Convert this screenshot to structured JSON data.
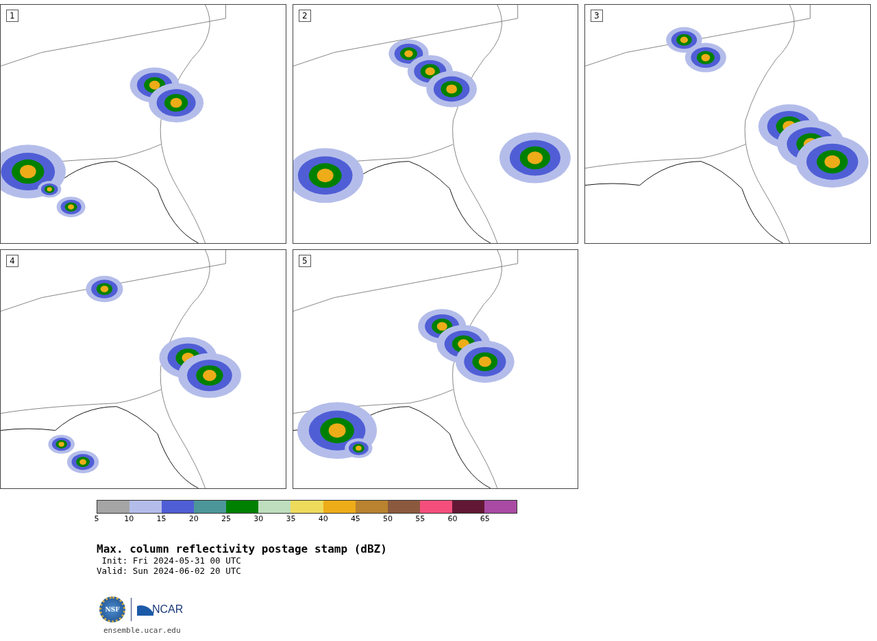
{
  "panels": [
    {
      "number": "1",
      "kind": "map-picture"
    },
    {
      "number": "2",
      "kind": "map-picture"
    },
    {
      "number": "3",
      "kind": "map-picture"
    },
    {
      "number": "4",
      "kind": "map-picture"
    },
    {
      "number": "5",
      "kind": "map-picture"
    }
  ],
  "colorbar": {
    "segments": [
      {
        "color": "#a5a5a5"
      },
      {
        "color": "#b4bdea"
      },
      {
        "color": "#505ed6"
      },
      {
        "color": "#4c969a"
      },
      {
        "color": "#008000"
      },
      {
        "color": "#bedebe"
      },
      {
        "color": "#eedb5c"
      },
      {
        "color": "#eeac19"
      },
      {
        "color": "#b9832f"
      },
      {
        "color": "#8b5a3e"
      },
      {
        "color": "#f44f7c"
      },
      {
        "color": "#621735"
      },
      {
        "color": "#a94ba4"
      }
    ],
    "ticks": [
      "5",
      "10",
      "15",
      "20",
      "25",
      "30",
      "35",
      "40",
      "45",
      "50",
      "55",
      "60",
      "65"
    ]
  },
  "title": "Max. column reflectivity postage stamp (dBZ)",
  "init": " Init: Fri 2024-05-31 00 UTC",
  "valid": "Valid: Sun 2024-06-02 20 UTC",
  "logo": {
    "seal": "NSF",
    "wordmark": "NCAR"
  },
  "footer_link": "ensemble.ucar.edu"
}
